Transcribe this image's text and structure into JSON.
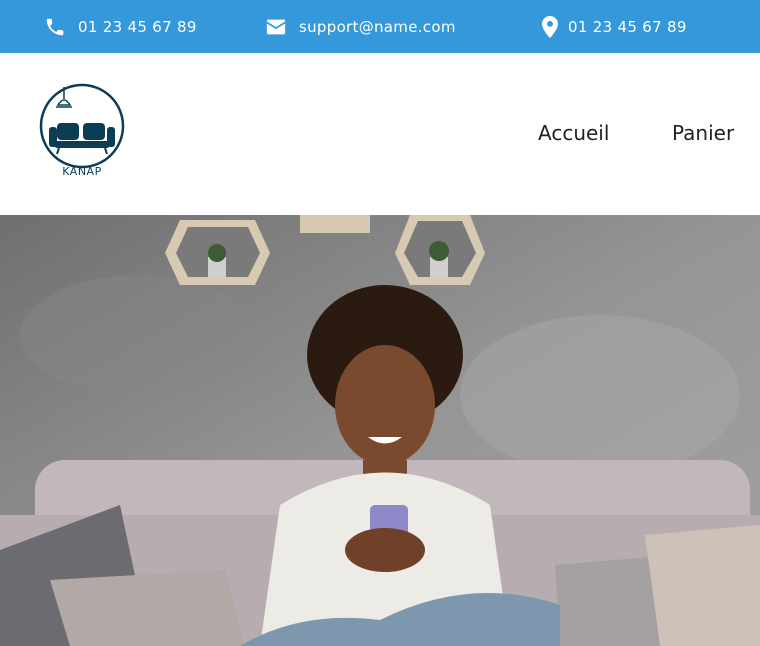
{
  "topbar": {
    "phone": "01 23 45 67 89",
    "email": "support@name.com",
    "address": "01 23 45 67 89"
  },
  "brand": {
    "logo_text": "KANAP"
  },
  "nav": {
    "items": [
      {
        "label": "Accueil"
      },
      {
        "label": "Panier"
      }
    ]
  },
  "colors": {
    "topbar_bg": "#3498db",
    "logo_color": "#0b3d55"
  },
  "icons": [
    "phone-icon",
    "mail-icon",
    "location-icon",
    "sofa-logo-icon"
  ]
}
